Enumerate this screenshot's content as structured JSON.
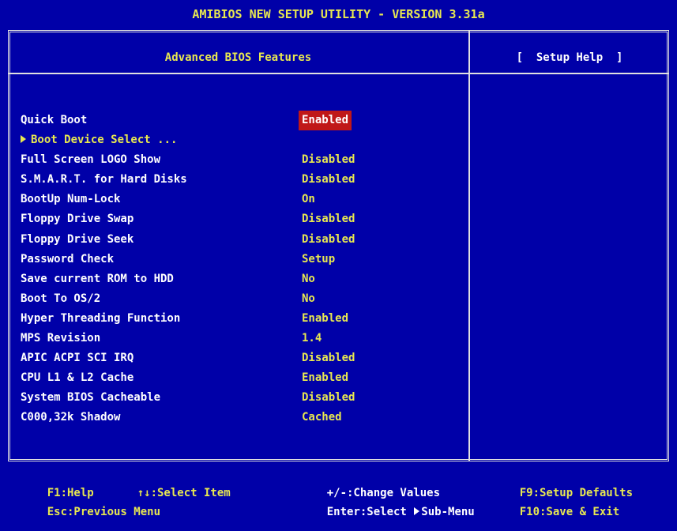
{
  "title": "AMIBIOS NEW SETUP UTILITY - VERSION 3.31a",
  "section_title": "Advanced BIOS Features",
  "help_title": "[  Setup Help  ]",
  "settings": [
    {
      "label": "Quick Boot",
      "value": "Enabled",
      "selected": true
    },
    {
      "label": "Boot Device Select ...",
      "value": "",
      "submenu": true
    },
    {
      "label": "Full Screen LOGO Show",
      "value": "Disabled"
    },
    {
      "label": "S.M.A.R.T. for Hard Disks",
      "value": "Disabled"
    },
    {
      "label": "BootUp Num-Lock",
      "value": "On"
    },
    {
      "label": "Floppy Drive Swap",
      "value": "Disabled"
    },
    {
      "label": "Floppy Drive Seek",
      "value": "Disabled"
    },
    {
      "label": "Password Check",
      "value": "Setup"
    },
    {
      "label": "Save current ROM to HDD",
      "value": "No"
    },
    {
      "label": "Boot To OS/2",
      "value": "No"
    },
    {
      "label": "Hyper Threading Function",
      "value": "Enabled"
    },
    {
      "label": "MPS Revision",
      "value": "1.4"
    },
    {
      "label": "APIC ACPI SCI IRQ",
      "value": "Disabled"
    },
    {
      "label": "CPU L1 & L2 Cache",
      "value": "Enabled"
    },
    {
      "label": "System BIOS Cacheable",
      "value": "Disabled"
    },
    {
      "label": "C000,32k Shadow",
      "value": "Cached"
    }
  ],
  "footer": {
    "f1": "F1:Help",
    "select_item": "↑↓:Select Item",
    "change_values": "+/-:Change Values",
    "f9": "F9:Setup Defaults",
    "esc": "Esc:Previous Menu",
    "enter_prefix": "Enter:Select ",
    "enter_suffix": "Sub-Menu",
    "f10": "F10:Save & Exit"
  },
  "colors": {
    "background": "#0000a8",
    "text_yellow": "#e8e850",
    "text_white": "#ffffff",
    "highlight": "#c01818"
  }
}
